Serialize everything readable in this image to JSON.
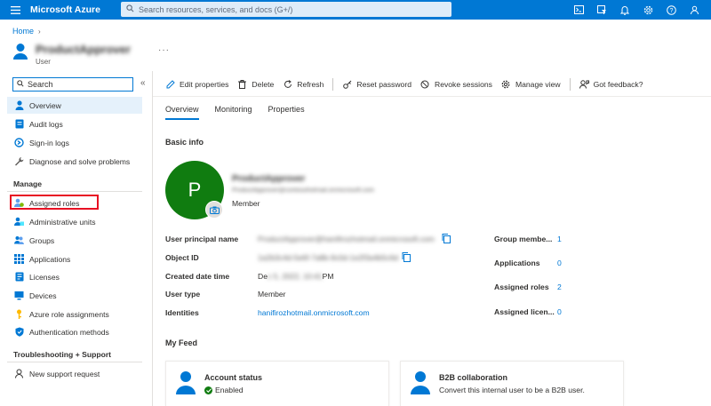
{
  "topbar": {
    "brand": "Microsoft Azure",
    "search_placeholder": "Search resources, services, and docs (G+/)",
    "icons": [
      "cloud-shell-icon",
      "directory-filter-icon",
      "notifications-icon",
      "settings-icon",
      "help-icon",
      "feedback-icon"
    ]
  },
  "breadcrumb": {
    "home": "Home"
  },
  "title": {
    "name": "ProductApprover",
    "subtitle": "User"
  },
  "sidebar": {
    "search_placeholder": "Search",
    "items_top": [
      {
        "label": "Overview",
        "icon": "overview-icon"
      },
      {
        "label": "Audit logs",
        "icon": "audit-logs-icon"
      },
      {
        "label": "Sign-in logs",
        "icon": "sign-in-logs-icon"
      },
      {
        "label": "Diagnose and solve problems",
        "icon": "wrench-icon"
      }
    ],
    "manage_heading": "Manage",
    "items_manage": [
      {
        "label": "Assigned roles",
        "icon": "assigned-roles-icon"
      },
      {
        "label": "Administrative units",
        "icon": "admin-units-icon"
      },
      {
        "label": "Groups",
        "icon": "groups-icon"
      },
      {
        "label": "Applications",
        "icon": "applications-icon"
      },
      {
        "label": "Licenses",
        "icon": "licenses-icon"
      },
      {
        "label": "Devices",
        "icon": "devices-icon"
      },
      {
        "label": "Azure role assignments",
        "icon": "key-icon"
      },
      {
        "label": "Authentication methods",
        "icon": "shield-icon"
      }
    ],
    "support_heading": "Troubleshooting + Support",
    "items_support": [
      {
        "label": "New support request",
        "icon": "support-request-icon"
      }
    ]
  },
  "toolbar": {
    "edit": "Edit properties",
    "delete": "Delete",
    "refresh": "Refresh",
    "reset_password": "Reset password",
    "revoke_sessions": "Revoke sessions",
    "manage_view": "Manage view",
    "feedback": "Got feedback?"
  },
  "tabs": [
    "Overview",
    "Monitoring",
    "Properties"
  ],
  "basic_info": {
    "heading": "Basic info",
    "avatar_letter": "P",
    "name": "ProductApprover",
    "email": "ProductApprover@contosohotmail.onmicrosoft.com",
    "role": "Member"
  },
  "properties": {
    "upn_label": "User principal name",
    "upn_value": "ProductApprover@hanifirozhotmail.onmicrosoft.com",
    "object_id_label": "Object ID",
    "object_id_value": "1a2b3c4d-5e6f-7a8b-9c0d-1e2f3a4b5c6d",
    "created_label": "Created date time",
    "created_prefix": "De",
    "created_blurred": "c 5, 2022, 10:41",
    "created_suffix": "PM",
    "user_type_label": "User type",
    "user_type_value": "Member",
    "identities_label": "Identities",
    "identities_value": "hanifirozhotmail.onmicrosoft.com"
  },
  "stats": [
    {
      "label": "Group membe...",
      "value": "1"
    },
    {
      "label": "Applications",
      "value": "0"
    },
    {
      "label": "Assigned roles",
      "value": "2"
    },
    {
      "label": "Assigned licen...",
      "value": "0"
    }
  ],
  "feed": {
    "heading": "My Feed",
    "cards": [
      {
        "title": "Account status",
        "subtitle": "Enabled",
        "icon": "user-icon"
      },
      {
        "title": "B2B collaboration",
        "subtitle": "Convert this internal user to be a B2B user.",
        "icon": "user-icon"
      }
    ]
  },
  "colors": {
    "accent": "#0078d4",
    "avatar_bg": "#107c10",
    "highlight": "#e81123"
  }
}
